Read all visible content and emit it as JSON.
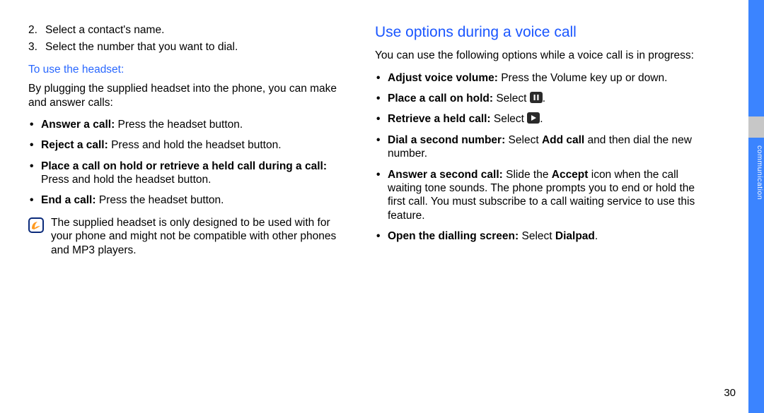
{
  "sidebar": {
    "label": "communication"
  },
  "page_number": "30",
  "left": {
    "step2_num": "2.",
    "step2_text": "Select a contact's name.",
    "step3_num": "3.",
    "step3_text": "Select the number that you want to dial.",
    "sub_heading": "To use the headset:",
    "intro": "By plugging the supplied headset into the phone, you can make and answer calls:",
    "b1_b": "Answer a call:",
    "b1_r": " Press the headset button.",
    "b2_b": "Reject a call:",
    "b2_r": " Press and hold the headset button.",
    "b3_b": "Place a call on hold or retrieve a held call during a call:",
    "b3_r": " Press and hold the headset button.",
    "b4_b": "End a call:",
    "b4_r": " Press the headset button.",
    "note": "The supplied headset is only designed to be used with for your phone and might not be compatible with other phones and MP3 players."
  },
  "right": {
    "heading": "Use options during a voice call",
    "intro": "You can use the following options while a voice call is in progress:",
    "r1_b": "Adjust voice volume:",
    "r1_r": " Press the Volume key up or down.",
    "r2_b": "Place a call on hold:",
    "r2_pre": " Select ",
    "r2_post": ".",
    "r3_b": "Retrieve a held call:",
    "r3_pre": " Select ",
    "r3_post": ".",
    "r4_b": "Dial a second number:",
    "r4_pre": " Select ",
    "r4_mid_b": "Add call",
    "r4_post": " and then dial the new number.",
    "r5_b": "Answer a second call:",
    "r5_pre": " Slide the ",
    "r5_mid_b": "Accept",
    "r5_post": " icon when the call waiting tone sounds. The phone prompts you to end or hold the first call. You must subscribe to a call waiting service to use this feature.",
    "r6_b": "Open the dialling screen:",
    "r6_pre": " Select ",
    "r6_mid_b": "Dialpad",
    "r6_post": "."
  }
}
